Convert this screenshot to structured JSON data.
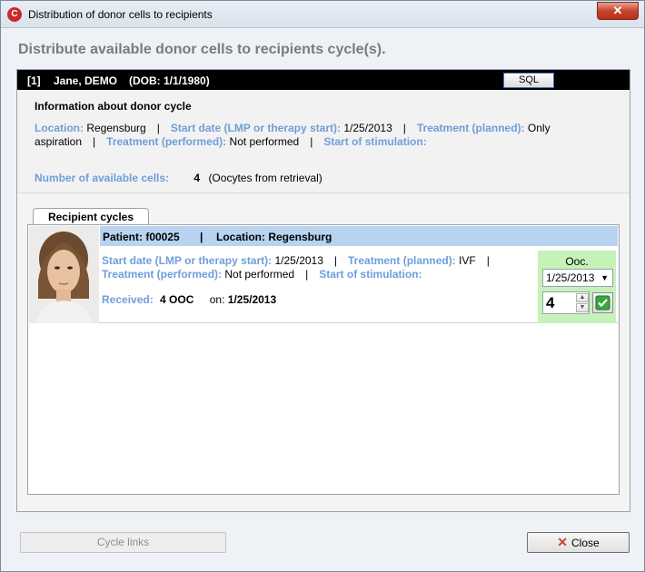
{
  "window": {
    "title": "Distribution of donor cells to recipients",
    "close_glyph": "✕",
    "app_icon_glyph": "C"
  },
  "heading": "Distribute available donor cells to recipients cycle(s).",
  "patient_bar": {
    "number": "[1]",
    "name": "Jane, DEMO",
    "dob": "(DOB: 1/1/1980)",
    "sql_label": "SQL"
  },
  "donor_cycle": {
    "heading": "Information about donor cycle",
    "location_label": "Location:",
    "location_value": "Regensburg",
    "start_date_label": "Start date (LMP or therapy start):",
    "start_date_value": "1/25/2013",
    "treatment_planned_label": "Treatment (planned):",
    "treatment_planned_value_part1": "Only",
    "treatment_planned_value_part2": "aspiration",
    "treatment_performed_label": "Treatment (performed):",
    "treatment_performed_value": "Not performed",
    "start_stimulation_label": "Start of stimulation:",
    "available_cells_label": "Number of available cells:",
    "available_cells_value": "4",
    "available_cells_note": "(Oocytes from retrieval)",
    "separator": "|"
  },
  "tab": {
    "label": "Recipient cycles"
  },
  "recipient": {
    "patient_text": "Patient: f00025",
    "location_text": "Location: Regensburg",
    "separator": "|",
    "start_date_label": "Start date (LMP or therapy start):",
    "start_date_value": "1/25/2013",
    "treatment_planned_label": "Treatment (planned):",
    "treatment_planned_value": "IVF",
    "treatment_performed_label": "Treatment (performed):",
    "treatment_performed_value": "Not performed",
    "start_stimulation_label": "Start of stimulation:",
    "received_label": "Received:",
    "received_value": "4 OOC",
    "received_on_label": "on:",
    "received_on_value": "1/25/2013",
    "ooc_label": "Ooc.",
    "ooc_date": "1/25/2013",
    "ooc_count": "4",
    "spin_up": "▲",
    "spin_down": "▼",
    "caret": "▼"
  },
  "buttons": {
    "cycle_links": "Cycle links",
    "close": "Close"
  },
  "colors": {
    "label_blue": "#6f9ed9",
    "recipient_header": "#b7d3ef",
    "ooc_green": "#c6f1b9",
    "close_red": "#c7432e"
  }
}
